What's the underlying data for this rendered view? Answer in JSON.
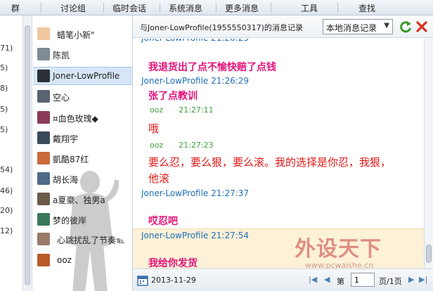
{
  "tabbar": {
    "tabs": [
      {
        "label": "群"
      },
      {
        "label": "讨论组"
      },
      {
        "label": "临时会话"
      },
      {
        "label": "系统消息"
      },
      {
        "label": "更多消息"
      },
      {
        "label": "工具"
      },
      {
        "label": "查找"
      }
    ]
  },
  "left_numbers": [
    "71)",
    "5)",
    "8)",
    "5)",
    "5)",
    "54)",
    "46)",
    "20)",
    "12)"
  ],
  "contacts": [
    {
      "name": "蜡笔小新\"",
      "color": "#f1c7a0"
    },
    {
      "name": "陈凯",
      "color": "#7f8a94"
    },
    {
      "name": "Joner-LowProfile",
      "color": "#2b2f36",
      "selected": true
    },
    {
      "name": "空心",
      "color": "#5a6470"
    },
    {
      "name": "¤血色玫瑰◆",
      "color": "#8a3a5a"
    },
    {
      "name": "戴翔宇",
      "color": "#3a4a5a"
    },
    {
      "name": "凱酷87红",
      "color": "#c96a3a"
    },
    {
      "name": "胡长海",
      "color": "#4e6a88"
    },
    {
      "name": "a夏豪、独男a",
      "color": "#6a5a4a"
    },
    {
      "name": "梦的彼岸",
      "color": "#3a7a5a"
    },
    {
      "name": "心跳扰乱了节奏℡",
      "color": "#9a7a6a"
    },
    {
      "name": "ooz",
      "color": "#b85a2a"
    }
  ],
  "record": {
    "title": "与Joner-LowProfile(1955550317)的消息记录",
    "range_select": "本地消息记录",
    "messages": [
      {
        "sender": "",
        "time": "",
        "text": "我退货出了点不愉快赔了点钱",
        "style": "pinkbold"
      },
      {
        "sender": "Joner-LowProfile",
        "time": "21:26:29",
        "text": "张了点教训",
        "style": "pinkbold"
      },
      {
        "sender": "ooz",
        "time": "21:27:11",
        "text": "哦",
        "style": "red"
      },
      {
        "sender": "ooz",
        "time": "21:27:23",
        "text": "要么忍，要么狠，要么滚。我的选择是你忍，我狠，",
        "text2": "他滚",
        "style": "red"
      },
      {
        "sender": "Joner-LowProfile",
        "time": "21:27:37",
        "text": "哎忍吧",
        "style": "pinkbold"
      },
      {
        "sender": "Joner-LowProfile",
        "time": "21:27:54",
        "text": "我给你发货",
        "style": "pinkbold"
      }
    ],
    "watermark": "外设天下",
    "watermark_url": "www.pcwaishe.cn"
  },
  "footer": {
    "date": "2013-11-29",
    "page_prefix": "第",
    "page_value": "1",
    "page_suffix": "页/1页"
  }
}
